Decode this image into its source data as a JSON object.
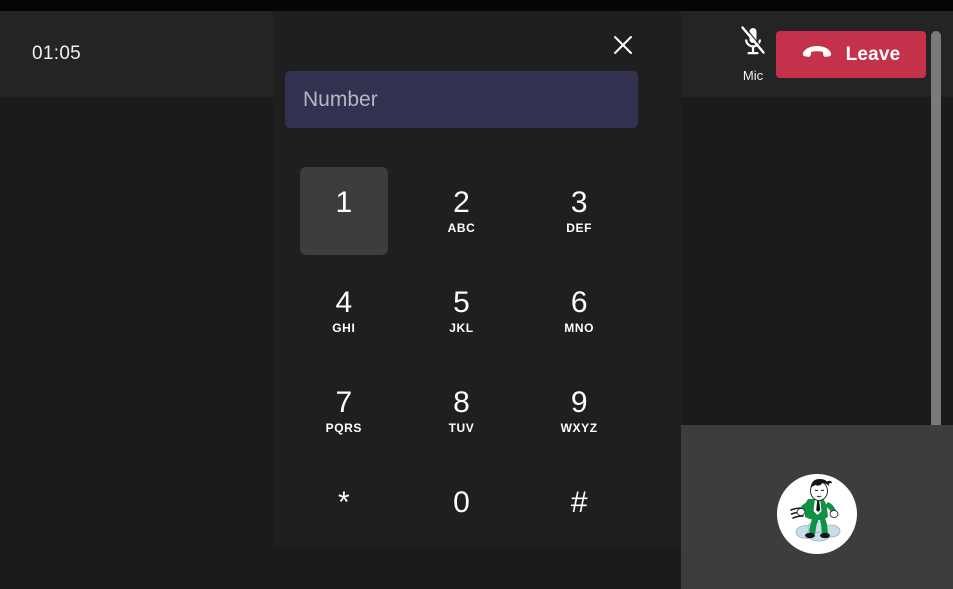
{
  "app": {
    "name": "teams-meeting-dialpad",
    "colors": {
      "background": "#1b1b1b",
      "panel": "#1f1f1f",
      "toolbar": "#242424",
      "leave_red": "#c4314b",
      "input_field": "#323250",
      "key_hover": "#3d3d3d",
      "tile": "#3d3d3d",
      "scrollbar": "#7a7a7a"
    }
  },
  "toolbar": {
    "call_timer": "01:05",
    "mic": {
      "label": "Mic",
      "icon": "microphone-muted-icon",
      "muted": true
    },
    "leave": {
      "label": "Leave",
      "icon": "hangup-phone-icon"
    }
  },
  "dialpad": {
    "close_icon": "close-icon",
    "close_label": "Close",
    "number_input": {
      "placeholder": "Number",
      "value": ""
    },
    "keys": [
      {
        "digit": "1",
        "letters": "",
        "hovered": true
      },
      {
        "digit": "2",
        "letters": "ABC",
        "hovered": false
      },
      {
        "digit": "3",
        "letters": "DEF",
        "hovered": false
      },
      {
        "digit": "4",
        "letters": "GHI",
        "hovered": false
      },
      {
        "digit": "5",
        "letters": "JKL",
        "hovered": false
      },
      {
        "digit": "6",
        "letters": "MNO",
        "hovered": false
      },
      {
        "digit": "7",
        "letters": "PQRS",
        "hovered": false
      },
      {
        "digit": "8",
        "letters": "TUV",
        "hovered": false
      },
      {
        "digit": "9",
        "letters": "WXYZ",
        "hovered": false
      },
      {
        "digit": "*",
        "letters": "",
        "hovered": false
      },
      {
        "digit": "0",
        "letters": "",
        "hovered": false
      },
      {
        "digit": "#",
        "letters": "",
        "hovered": false
      }
    ]
  },
  "video_tile": {
    "avatar_icon": "cartoon-man-on-cloud-avatar"
  }
}
